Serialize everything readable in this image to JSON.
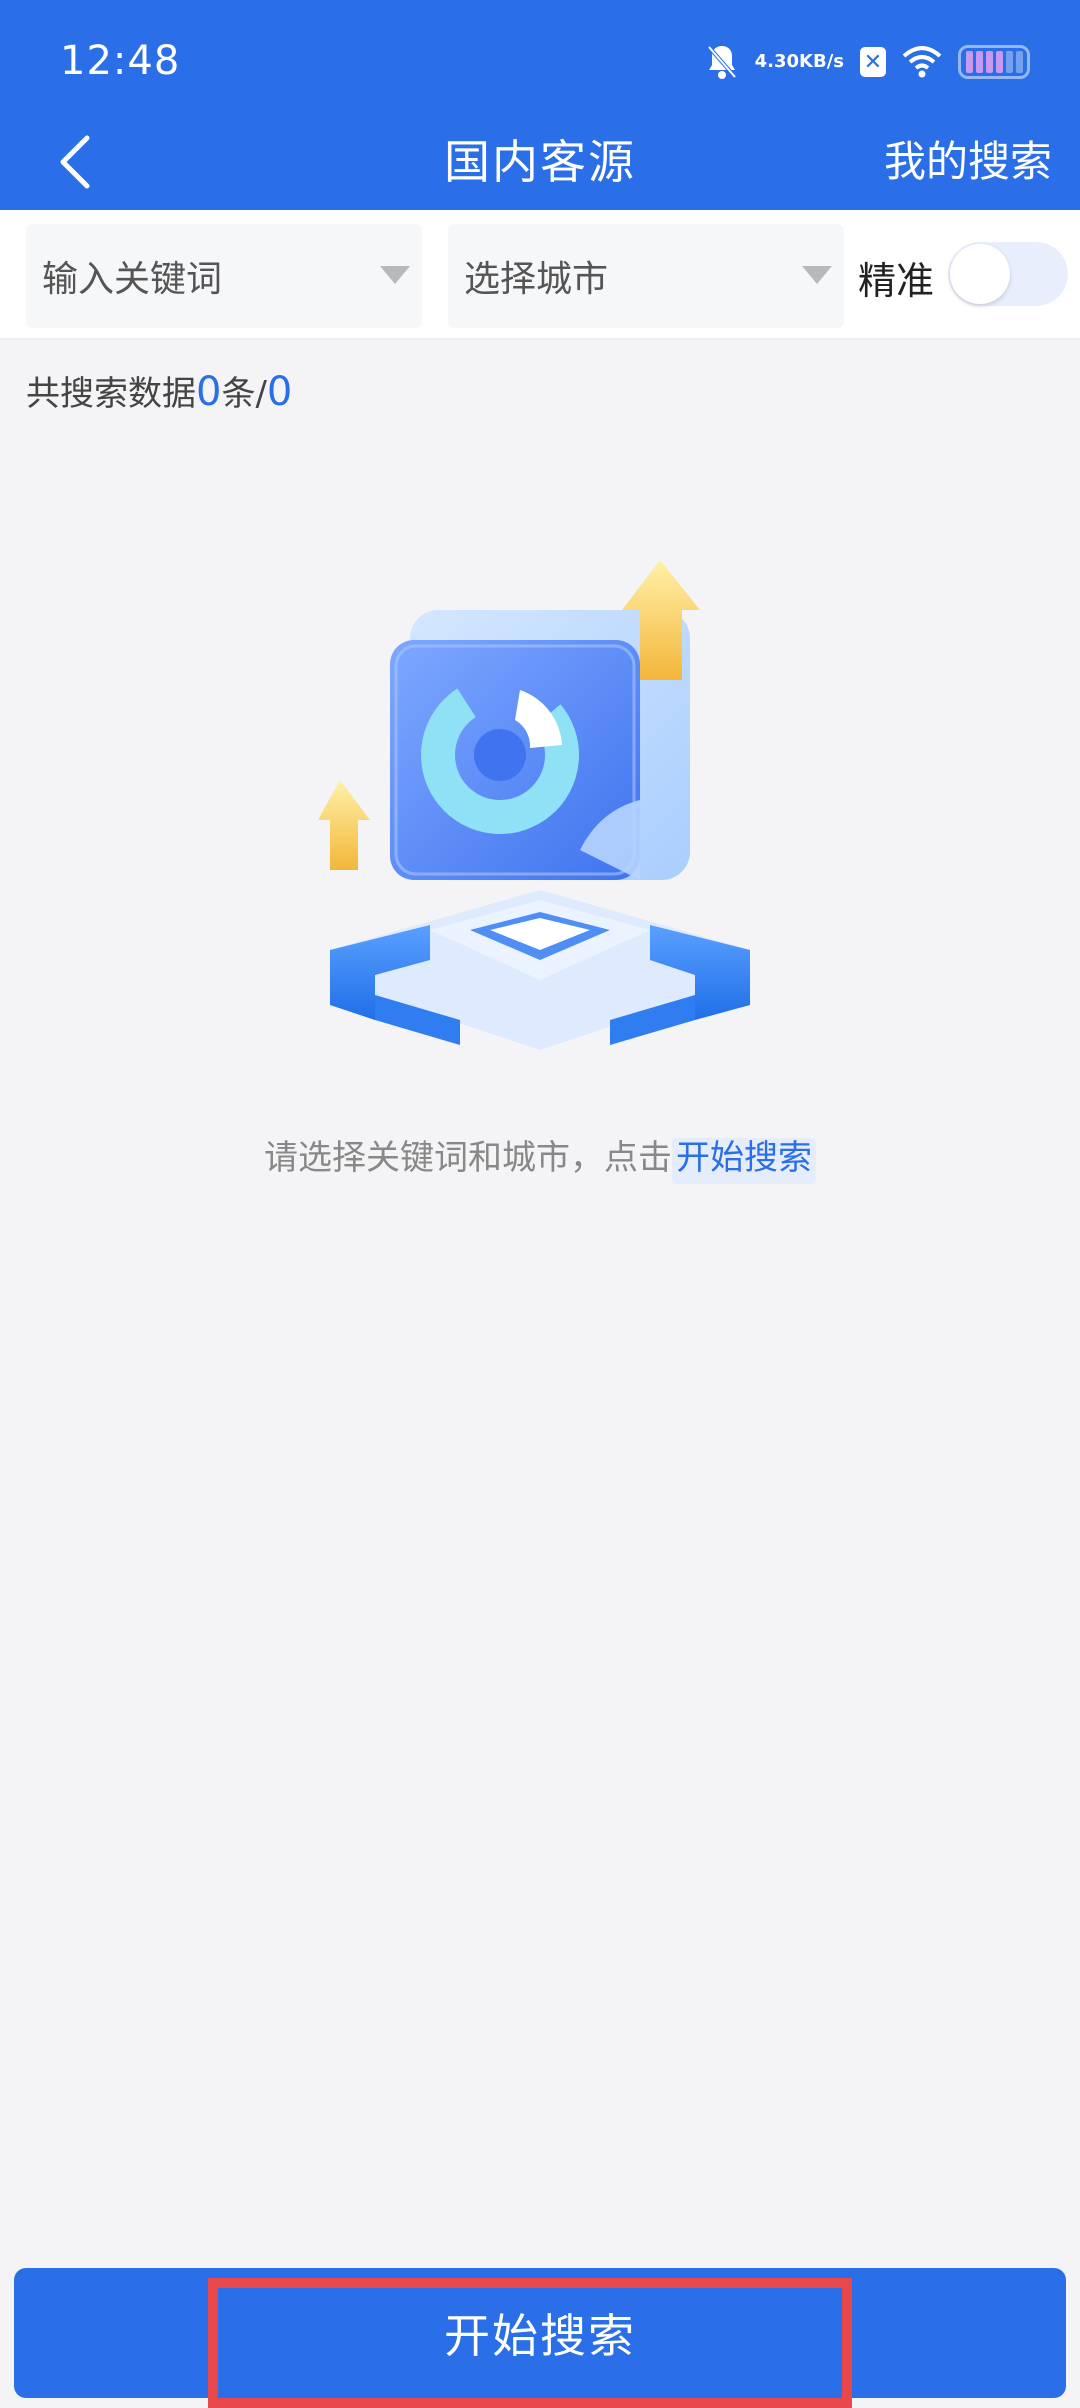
{
  "status_bar": {
    "time": "12:48",
    "net_speed_value": "4.30",
    "net_speed_unit": "KB/s",
    "icons": [
      "mute-bell-icon",
      "x-app-icon",
      "wifi-icon",
      "battery-icon"
    ]
  },
  "nav": {
    "title": "国内客源",
    "right_action": "我的搜索",
    "back_icon": "chevron-left-icon"
  },
  "filters": {
    "keyword_placeholder": "输入关键词",
    "city_placeholder": "选择城市",
    "precise_label": "精准",
    "precise_enabled": false
  },
  "summary": {
    "prefix": "共搜索数据",
    "count": "0",
    "unit": "条",
    "separator": "/",
    "total": "0"
  },
  "empty_state": {
    "hint_text": "请选择关键词和城市，点击",
    "hint_link": "开始搜索"
  },
  "bottom": {
    "search_button": "开始搜索"
  },
  "colors": {
    "brand_blue": "#2a6ee8",
    "background": "#f4f4f6",
    "highlight_red": "#e8484b"
  }
}
